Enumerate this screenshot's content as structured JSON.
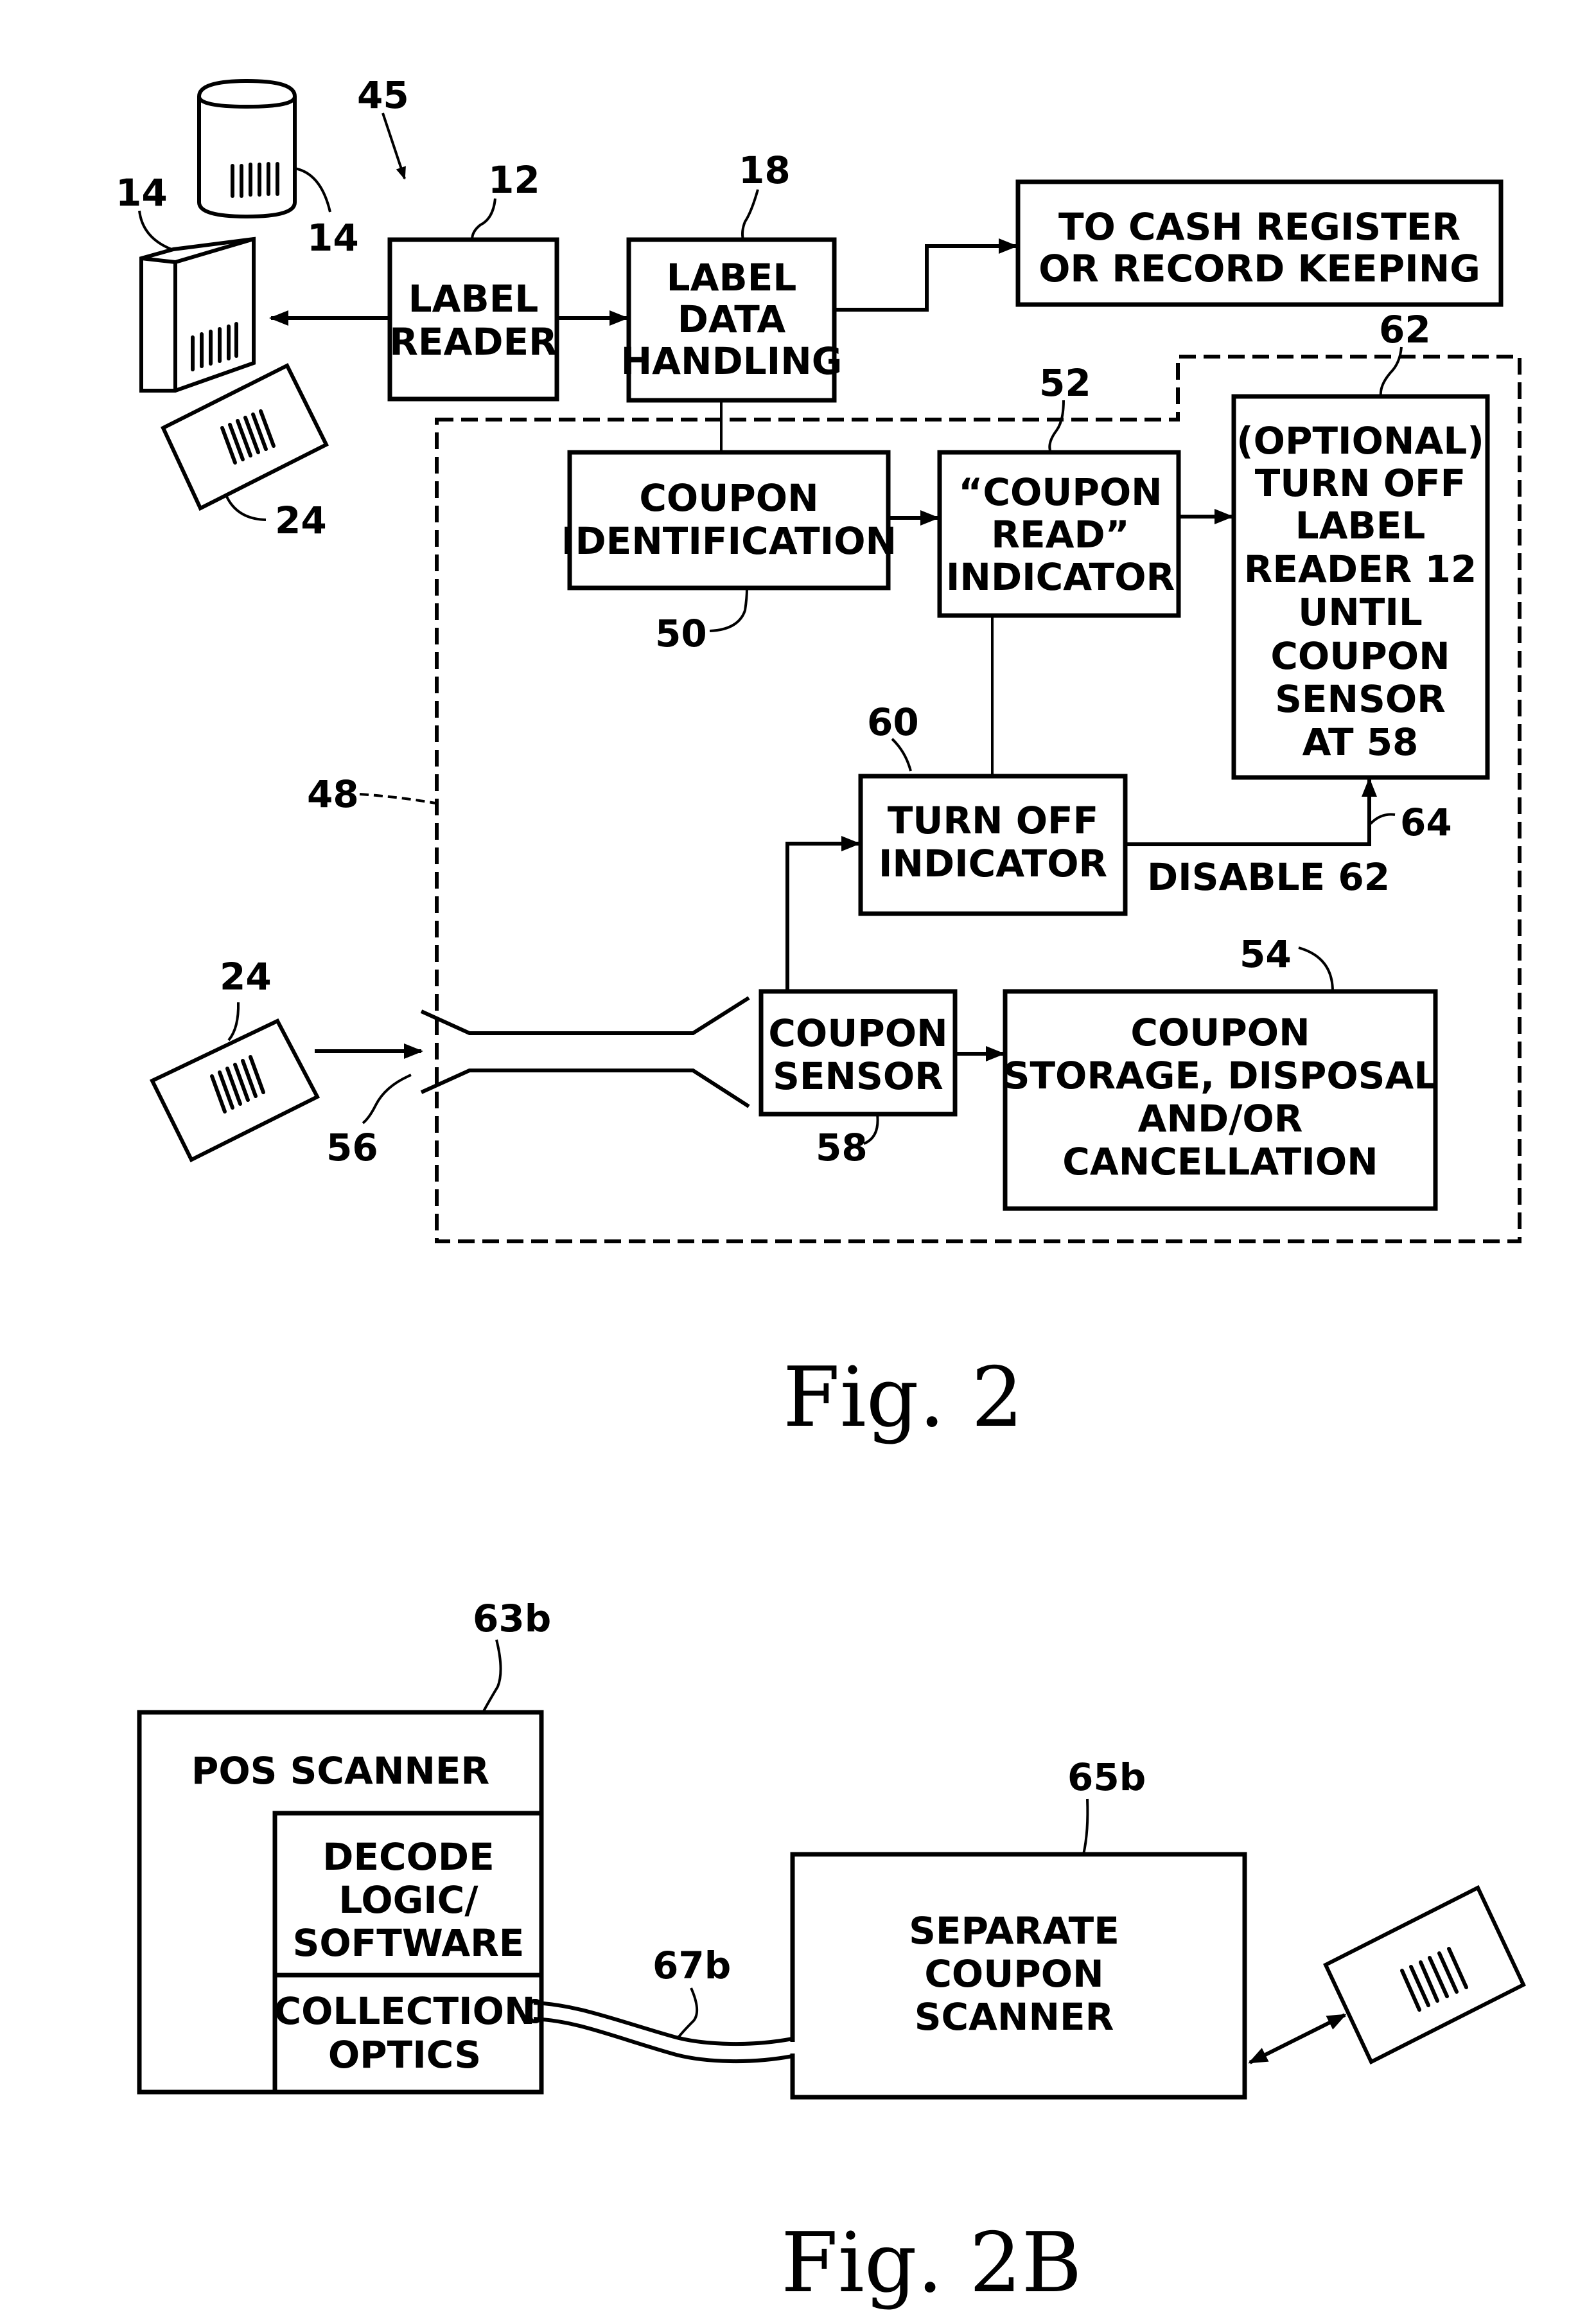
{
  "figures": [
    {
      "caption": "Fig. 2",
      "system_ref": "45",
      "enclosure_ref": "48",
      "blocks": {
        "label_reader": {
          "ref": "12",
          "lines": [
            "LABEL",
            "READER"
          ]
        },
        "label_data_handling": {
          "ref": "18",
          "lines": [
            "LABEL",
            "DATA",
            "HANDLING"
          ]
        },
        "cash_register": {
          "lines": [
            "TO CASH REGISTER",
            "OR RECORD KEEPING"
          ]
        },
        "coupon_identification": {
          "ref": "50",
          "lines": [
            "COUPON",
            "IDENTIFICATION"
          ]
        },
        "coupon_read_indicator": {
          "ref": "52",
          "lines": [
            "“COUPON",
            "READ”",
            "INDICATOR"
          ]
        },
        "optional_turn_off": {
          "ref": "62",
          "lines": [
            "(OPTIONAL)",
            "TURN OFF",
            "LABEL",
            "READER 12",
            "UNTIL",
            "COUPON",
            "SENSOR",
            "AT 58"
          ]
        },
        "turn_off_indicator": {
          "ref": "60",
          "lines": [
            "TURN OFF",
            "INDICATOR"
          ]
        },
        "coupon_sensor": {
          "ref": "58",
          "lines": [
            "COUPON",
            "SENSOR"
          ]
        },
        "coupon_storage": {
          "ref": "54",
          "lines": [
            "COUPON",
            "STORAGE, DISPOSAL",
            "AND/OR",
            "CANCELLATION"
          ]
        }
      },
      "disable_label": "DISABLE 62",
      "disable_ref": "64",
      "items": {
        "product_box_ref": "14",
        "product_can_ref": "14",
        "coupon_top_ref": "24",
        "coupon_slot_ref": "24",
        "slot_ref": "56"
      }
    },
    {
      "caption": "Fig. 2B",
      "blocks": {
        "pos_scanner": {
          "ref": "63b",
          "title": "POS SCANNER"
        },
        "decode_logic": {
          "lines": [
            "DECODE",
            "LOGIC/",
            "SOFTWARE"
          ]
        },
        "collection_optics": {
          "lines": [
            "COLLECTION",
            "OPTICS"
          ]
        },
        "separate_scanner": {
          "ref": "65b",
          "lines": [
            "SEPARATE",
            "COUPON",
            "SCANNER"
          ]
        }
      },
      "cable_ref": "67b"
    }
  ]
}
